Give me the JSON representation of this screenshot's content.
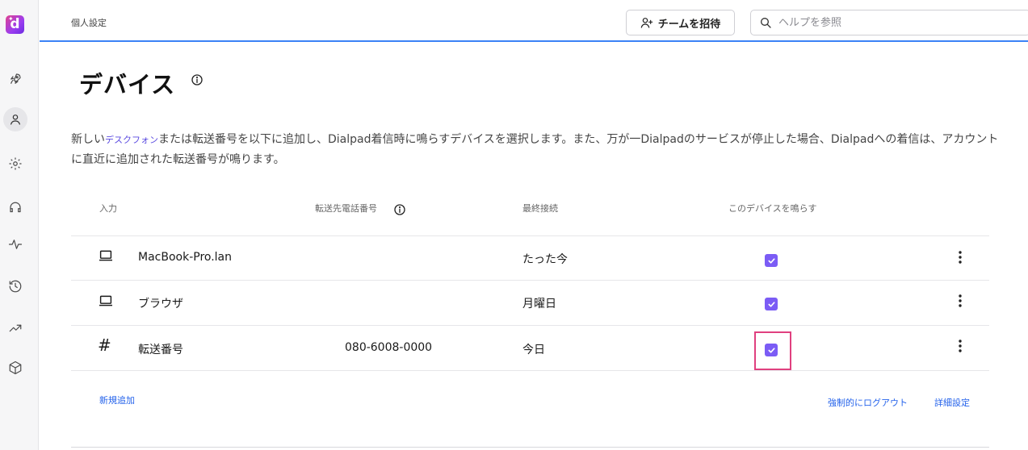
{
  "app": {
    "logo_letter": "d"
  },
  "topbar": {
    "crumb": "個人設定",
    "invite_label": "チームを招待",
    "help_placeholder": "ヘルプを参照"
  },
  "page": {
    "title": "デバイス",
    "description_before": "新しい",
    "description_link": "デスクフォン",
    "description_after": "または転送番号を以下に追加し、Dialpad着信時に鳴らすデバイスを選択します。また、万が一Dialpadのサービスが停止した場合、Dialpadへの着信は、アカウントに直近に追加された転送番号が鳴ります。"
  },
  "table": {
    "headers": {
      "input": "入力",
      "forward_number": "転送先電話番号",
      "last_connected": "最終接続",
      "ring": "このデバイスを鳴らす"
    },
    "rows": [
      {
        "icon": "laptop-icon",
        "name": "MacBook-Pro.lan",
        "number": "",
        "last": "たった今",
        "ring": true
      },
      {
        "icon": "laptop-icon",
        "name": "ブラウザ",
        "number": "",
        "last": "月曜日",
        "ring": true
      },
      {
        "icon": "hash-icon",
        "name": "転送番号",
        "number": "080-6008-0000",
        "last": "今日",
        "ring": true
      }
    ]
  },
  "actions": {
    "add_new": "新規追加",
    "force_logout": "強制的にログアウト",
    "advanced": "詳細設定"
  },
  "colors": {
    "accent": "#7b5cf5",
    "link": "#2563eb",
    "highlight": "#e0407f",
    "topbar_border": "#3b82f6"
  }
}
